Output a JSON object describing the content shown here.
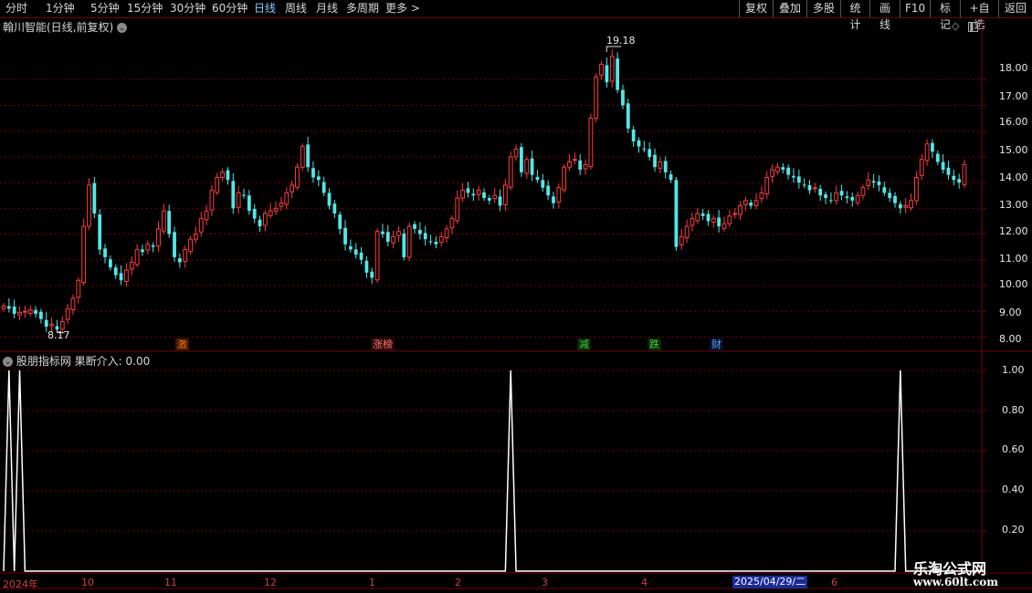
{
  "toolbar": {
    "periods": [
      "分时",
      "1分钟",
      "5分钟",
      "15分钟",
      "30分钟",
      "60分钟",
      "日线",
      "周线",
      "月线",
      "多周期",
      "更多 >"
    ],
    "active_period": "日线",
    "right_buttons": [
      "复权",
      "叠加",
      "多股",
      "统计",
      "画线",
      "F10",
      "标记",
      "+自选",
      "返回"
    ]
  },
  "main_chart": {
    "title": "翰川智能(日线,前复权)",
    "high_label": "19.18",
    "low_label": "8.17",
    "y_ticks": [
      "18.00",
      "17.00",
      "16.00",
      "15.00",
      "14.00",
      "13.00",
      "12.00",
      "11.00",
      "10.00",
      "9.00",
      "8.00"
    ],
    "events": [
      {
        "label": "激",
        "color": "#ff6a00",
        "bg": "#3a1a00"
      },
      {
        "label": "涨榜",
        "color": "#ff7070",
        "bg": "#2a0a0a"
      },
      {
        "label": "减",
        "color": "#40d040",
        "bg": "#062806"
      },
      {
        "label": "跌",
        "color": "#40d040",
        "bg": "#062806"
      },
      {
        "label": "财",
        "color": "#60a0ff",
        "bg": "#061030"
      }
    ]
  },
  "indicator": {
    "title": "股朋指标网 果断介入: 0.00",
    "y_ticks": [
      "1.00",
      "0.80",
      "0.60",
      "0.40",
      "0.20"
    ]
  },
  "x_axis": {
    "labels": [
      "2024年",
      "10",
      "11",
      "12",
      "1",
      "2",
      "3",
      "4",
      "6"
    ],
    "highlight_date": "2025/04/29/二"
  },
  "watermark": {
    "line1": "乐淘公式网",
    "line2": "www.60lt.com"
  },
  "colors": {
    "up": "#ff3c3c",
    "down": "#50e8e8",
    "grid": "#7a0000",
    "signal": "#ffffff"
  },
  "chart_data": [
    {
      "type": "candlestick",
      "title": "翰川智能(日线,前复权)",
      "ylim": [
        7.8,
        19.5
      ],
      "annotated_high": 19.18,
      "annotated_low": 8.17,
      "closes": [
        9.2,
        9.1,
        8.9,
        8.95,
        9.0,
        9.05,
        8.9,
        8.7,
        8.4,
        8.5,
        8.3,
        8.6,
        9.1,
        9.5,
        10.2,
        12.3,
        13.9,
        12.8,
        11.4,
        11.1,
        10.7,
        10.4,
        10.2,
        10.6,
        10.9,
        11.4,
        11.3,
        11.6,
        11.5,
        12.2,
        12.9,
        12.0,
        11.1,
        10.9,
        11.4,
        11.8,
        12.0,
        12.6,
        12.9,
        13.7,
        14.2,
        14.4,
        14.1,
        13.0,
        13.6,
        13.5,
        12.9,
        12.6,
        12.3,
        12.8,
        12.9,
        13.0,
        13.2,
        13.6,
        13.9,
        14.6,
        15.4,
        14.6,
        14.2,
        14.1,
        13.6,
        13.1,
        12.8,
        12.2,
        11.6,
        11.4,
        11.2,
        11.0,
        10.5,
        10.3,
        12.1,
        12.0,
        11.7,
        11.9,
        12.1,
        11.1,
        12.3,
        12.2,
        12.0,
        11.8,
        11.7,
        11.6,
        11.9,
        12.2,
        12.6,
        13.4,
        13.7,
        13.6,
        13.5,
        13.7,
        13.4,
        13.3,
        13.5,
        13.1,
        13.9,
        15.0,
        15.3,
        14.4,
        14.9,
        14.3,
        14.1,
        13.8,
        13.5,
        13.2,
        13.8,
        14.6,
        14.8,
        14.9,
        14.5,
        14.7,
        16.5,
        18.1,
        18.6,
        17.9,
        18.9,
        17.6,
        17.0,
        16.1,
        15.6,
        15.4,
        15.3,
        15.0,
        14.6,
        14.8,
        14.4,
        14.1,
        11.5,
        11.9,
        12.3,
        12.6,
        12.8,
        12.7,
        12.5,
        12.6,
        12.3,
        12.4,
        12.7,
        12.8,
        13.1,
        13.3,
        13.1,
        13.3,
        13.6,
        14.2,
        14.5,
        14.6,
        14.5,
        14.3,
        14.2,
        14.0,
        13.9,
        13.7,
        13.8,
        13.5,
        13.4,
        13.3,
        13.6,
        13.5,
        13.4,
        13.3,
        13.5,
        13.8,
        14.1,
        14.0,
        13.9,
        13.6,
        13.4,
        13.2,
        13.0,
        13.1,
        13.3,
        14.2,
        14.9,
        15.5,
        15.2,
        14.8,
        14.5,
        14.3,
        14.1,
        14.0,
        14.7
      ]
    },
    {
      "type": "line",
      "title": "股朋指标网 果断介入",
      "ylim": [
        0,
        1.05
      ],
      "signal_bars": [
        1,
        3,
        95,
        168
      ],
      "value": 0.0
    }
  ]
}
